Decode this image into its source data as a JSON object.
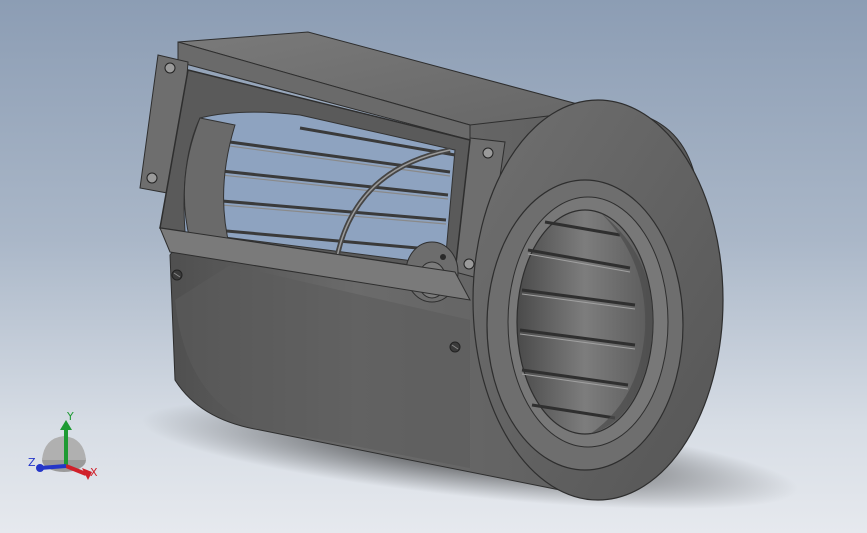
{
  "viewport": {
    "background_top": "#8c9db4",
    "background_bottom": "#e6e9ee",
    "model": "centrifugal-blower",
    "model_color": "#5f5f5f"
  },
  "triad": {
    "x_label": "X",
    "y_label": "Y",
    "z_label": "Z",
    "x_color": "#d0202a",
    "y_color": "#1e9a33",
    "z_color": "#2436c8"
  }
}
